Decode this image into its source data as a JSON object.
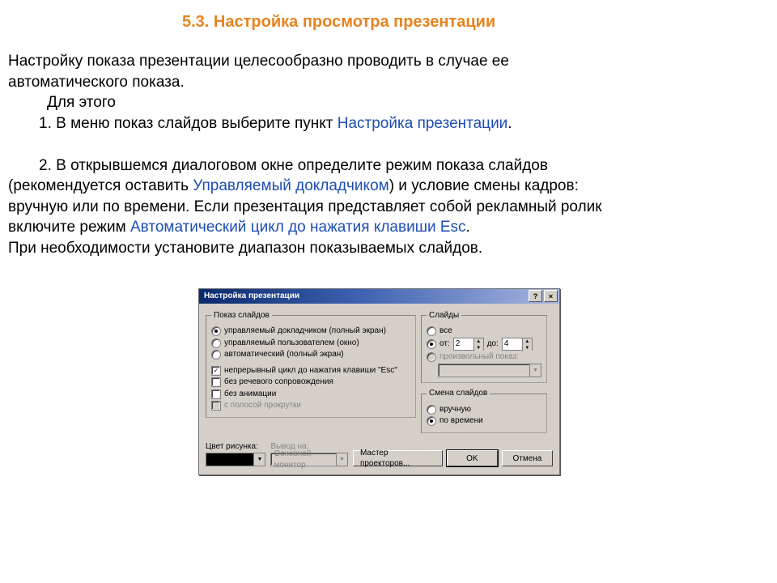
{
  "heading": "5.3.  Настройка просмотра презентации",
  "intro_line1": "Настройку показа презентации целесообразно проводить в случае ее",
  "intro_line2": "автоматического показа.",
  "for_this": "Для этого",
  "step1_prefix": "1.  В меню показ слайдов выберите пункт ",
  "step1_link": "Настройка презентации",
  "step1_suffix": ".",
  "step2_l1": "2.  В открывшемся диалоговом окне определите режим показа слайдов",
  "step2_l2a": "(рекомендуется оставить ",
  "step2_l2_link": "Управляемый докладчиком",
  "step2_l2b": ") и условие смены кадров:",
  "step2_l3": "вручную или по времени. Если презентация представляет собой рекламный ролик",
  "step2_l4a": "включите режим ",
  "step2_l4_link": "Автоматический цикл до нажатия клавиши Esc",
  "step2_l4b": ".",
  "step2_l5": "При необходимости установите диапазон  показываемых слайдов.",
  "dialog": {
    "title": "Настройка презентации",
    "help_btn": "?",
    "close_btn": "×",
    "group_show": {
      "legend": "Показ слайдов",
      "opt1": "управляемый докладчиком (полный экран)",
      "opt2": "управляемый пользователем (окно)",
      "opt3": "автоматический (полный экран)",
      "chk1": "непрерывный цикл до нажатия клавиши \"Esc\"",
      "chk2": "без речевого сопровождения",
      "chk3": "без анимации",
      "chk4": "с полосой прокрутки"
    },
    "group_slides": {
      "legend": "Слайды",
      "opt_all": "все",
      "opt_from": "от:",
      "from_val": "2",
      "to_lbl": "до:",
      "to_val": "4",
      "opt_custom": "произвольный показ:"
    },
    "group_advance": {
      "legend": "Смена слайдов",
      "opt_manual": "вручную",
      "opt_time": "по времени"
    },
    "color_label": "Цвет рисунка:",
    "output_label": "Вывод на:",
    "output_value": "Основной монитор",
    "btn_projectors": "Мастер проекторов...",
    "btn_ok": "OK",
    "btn_cancel": "Отмена"
  }
}
